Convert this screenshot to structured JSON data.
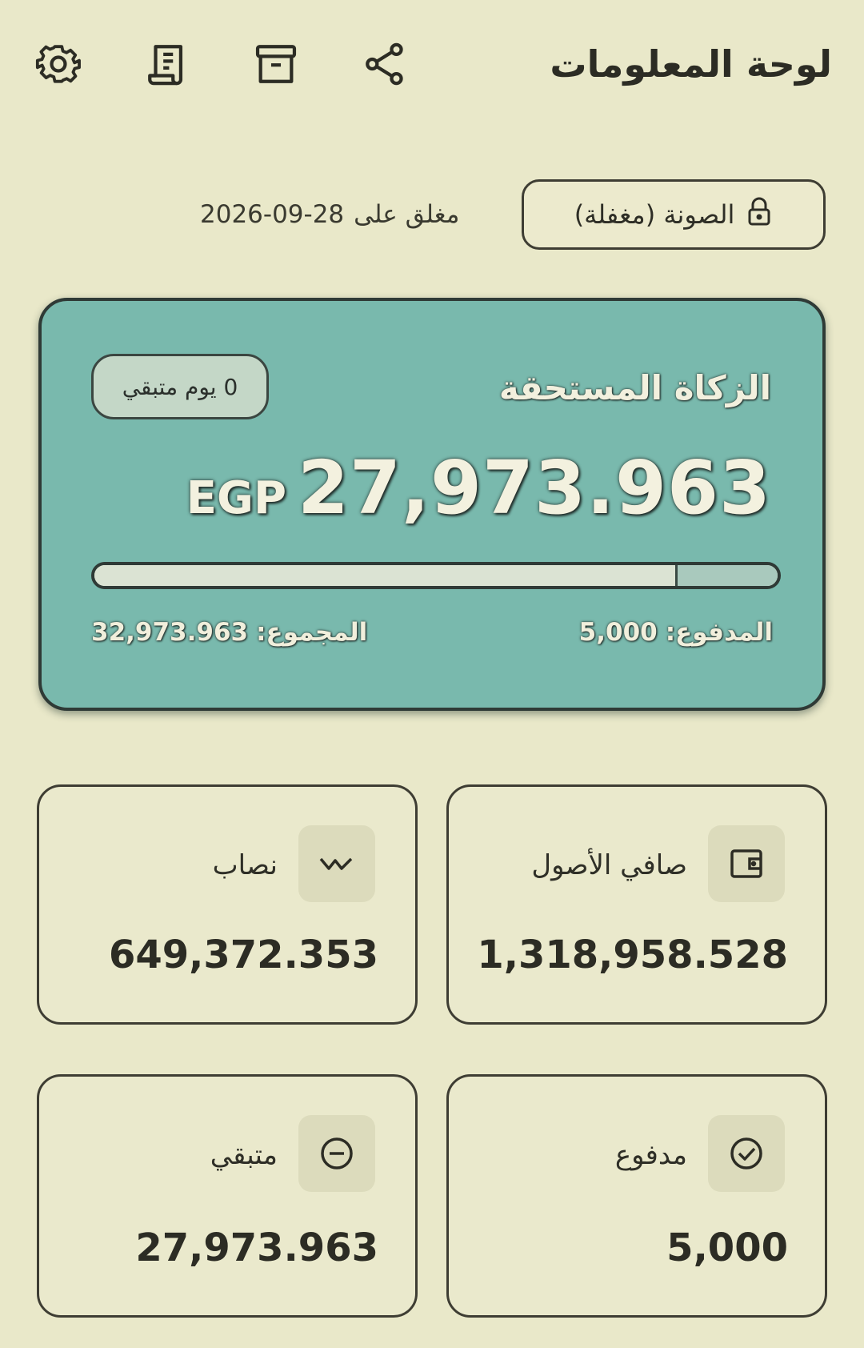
{
  "header": {
    "title": "لوحة المعلومات",
    "actions": [
      {
        "name": "settings",
        "icon": "gear-icon"
      },
      {
        "name": "report",
        "icon": "receipt-icon"
      },
      {
        "name": "archive",
        "icon": "archive-icon"
      },
      {
        "name": "share",
        "icon": "share-icon"
      }
    ]
  },
  "season": {
    "pill_label": "الصونة (مغفلة)",
    "icon": "lock-icon",
    "closed_on_label": "مغلق على",
    "closed_on_date": "2026-09-28"
  },
  "zakat": {
    "title": "الزكاة المستحقة",
    "days_badge": "0 يوم متبقي",
    "currency": "EGP",
    "amount": "27,973.963",
    "paid_label": "المدفوع:",
    "paid_value": "5,000",
    "total_label": "المجموع:",
    "total_value": "32,973.963",
    "progress_paid_fraction": 0.85
  },
  "stats": [
    {
      "key": "net_assets",
      "label": "صافي الأصول",
      "value": "1,318,958.528",
      "icon": "wallet-icon"
    },
    {
      "key": "nisab",
      "label": "نصاب",
      "value": "649,372.353",
      "icon": "trend-icon"
    },
    {
      "key": "paid",
      "label": "مدفوع",
      "value": "5,000",
      "icon": "check-circle-icon"
    },
    {
      "key": "remaining",
      "label": "متبقي",
      "value": "27,973.963",
      "icon": "minus-circle-icon"
    }
  ],
  "colors": {
    "background": "#e9e8c9",
    "card_accent": "#79b9ad",
    "border": "#3e3d33"
  }
}
